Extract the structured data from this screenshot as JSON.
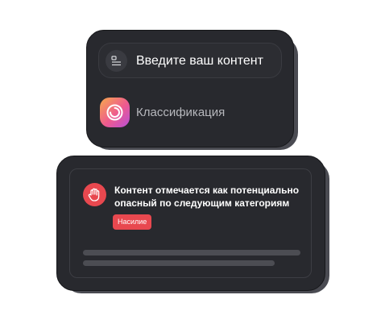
{
  "input": {
    "label": "Введите ваш контент",
    "icon": "text-lines-icon"
  },
  "classification": {
    "label": "Классификация",
    "icon": "spiral-icon"
  },
  "result": {
    "icon": "hand-stop-icon",
    "message": "Контент отмечается как потенциально опасный по следующим категориям",
    "badge": "Насилие"
  },
  "colors": {
    "card_bg": "#28292e",
    "card_shadow": "#4a4b52",
    "accent_red": "#e8484f"
  }
}
